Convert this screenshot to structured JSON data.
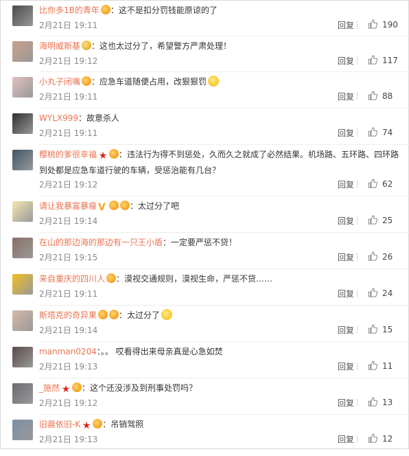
{
  "comments": [
    {
      "username": "比你多1B的青年",
      "badges": [
        "vip"
      ],
      "text": "：这不是扣分罚钱能原谅的了",
      "emoji": false,
      "time": "2月21日 19:11",
      "reply": "回复",
      "likes": "190",
      "avatar_color": "#4a4a4a"
    },
    {
      "username": "海明威斯基",
      "badges": [
        "gold"
      ],
      "text": "：这也太过分了，希望警方严肃处理！",
      "emoji": false,
      "time": "2月21日 19:12",
      "reply": "回复",
      "likes": "117",
      "avatar_color": "#c9a08a"
    },
    {
      "username": "小丸子闭嘴",
      "badges": [
        "vip"
      ],
      "text": "：应急车道随便占用，改狠狠罚",
      "emoji": true,
      "time": "2月21日 19:11",
      "reply": "回复",
      "likes": "88",
      "avatar_color": "#e3c0c0"
    },
    {
      "username": "WYLX999",
      "badges": [],
      "text": "：故意杀人",
      "emoji": false,
      "time": "2月21日 19:11",
      "reply": "回复",
      "likes": "74",
      "avatar_color": "#2f2f2f"
    },
    {
      "username": "樱桃的爹很幸福",
      "badges": [
        "star",
        "vip"
      ],
      "text": "：违法行为得不到惩处，久而久之就成了必然结果。机场路、五环路、四环路到处都是应急车道行驶的车辆，受惩治能有几台？",
      "emoji": false,
      "time": "2月21日 19:12",
      "reply": "回复",
      "likes": "62",
      "avatar_color": "#3d5566"
    },
    {
      "username": "请让我暴富暴瘦",
      "badges": [
        "v",
        "vip",
        "vip"
      ],
      "text": "：太过分了吧",
      "emoji": false,
      "time": "2月21日 19:14",
      "reply": "回复",
      "likes": "25",
      "avatar_color": "#f5e6b0"
    },
    {
      "username": "在山的那边海的那边有一只王小盾",
      "badges": [],
      "text": "：一定要严惩不贷！",
      "emoji": false,
      "time": "2月21日 19:15",
      "reply": "回复",
      "likes": "26",
      "avatar_color": "#8a6f66"
    },
    {
      "username": "来自重庆的四川人",
      "badges": [
        "vip"
      ],
      "text": "：漠视交通规则，漠视生命，严惩不贷……",
      "emoji": false,
      "time": "2月21日 19:11",
      "reply": "回复",
      "likes": "24",
      "avatar_color": "#f0c020"
    },
    {
      "username": "斯塔克的奇异果",
      "badges": [
        "vip",
        "vip"
      ],
      "text": "：太过分了",
      "emoji": true,
      "time": "2月21日 19:14",
      "reply": "回复",
      "likes": "15",
      "avatar_color": "#d8b8a8"
    },
    {
      "username": "manman0204",
      "badges": [],
      "text": "：。。 哎看得出来母亲真是心急如焚",
      "emoji": false,
      "time": "2月21日 19:13",
      "reply": "回复",
      "likes": "11",
      "avatar_color": "#5a4a48"
    },
    {
      "username": "_施然",
      "badges": [
        "star",
        "vip"
      ],
      "text": "：这个还没涉及到刑事处罚吗？",
      "emoji": false,
      "time": "2月21日 19:12",
      "reply": "回复",
      "likes": "13",
      "avatar_color": "#6a6a72"
    },
    {
      "username": "旧晨依旧-K",
      "badges": [
        "star",
        "vip"
      ],
      "text": "：吊销驾照",
      "emoji": false,
      "time": "2月21日 19:13",
      "reply": "回复",
      "likes": "12",
      "avatar_color": "#7a8fa6"
    }
  ]
}
